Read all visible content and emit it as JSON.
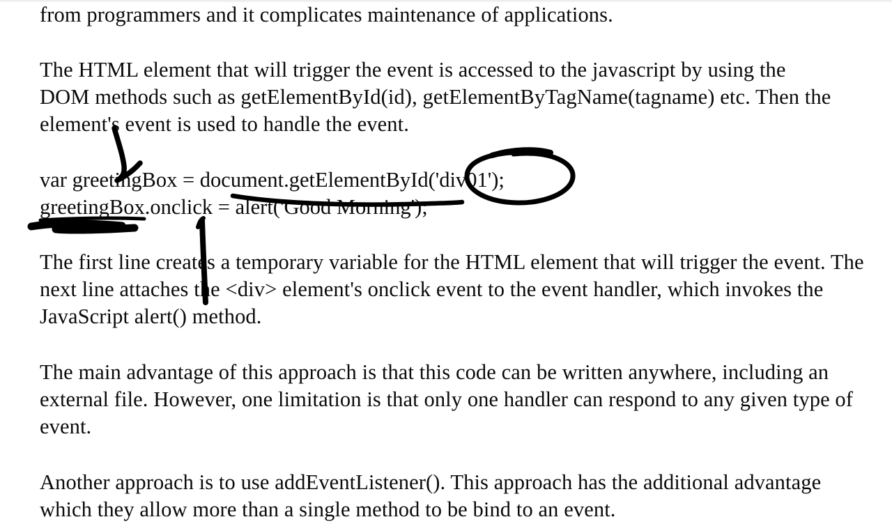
{
  "document": {
    "background_color": "#ffffff",
    "text_color": "#0a0a0a",
    "ink_color": "#000000",
    "paragraphs": {
      "p1_tail": "from programmers and it complicates maintenance of applications.",
      "p2_line1": "The HTML element that will trigger the event is accessed to the javascript by using the",
      "p2_line2": "DOM methods such as getElementById(id), getElementByTagName(tagname) etc. Then the",
      "p2_line3": "element's event is used to handle the event.",
      "p4_line1": "The first line creates a temporary variable for the HTML element that will trigger the event. The",
      "p4_line2": "next line attaches the <div> element's onclick event to the event handler, which invokes the",
      "p4_line3": "JavaScript alert() method.",
      "p5_line1": "The main advantage of this approach is that this code can be written anywhere, including an",
      "p5_line2": "external file. However, one limitation is that only one handler can respond to any given type of",
      "p5_line3": "event.",
      "p6_line1": "Another approach is to use addEventListener(). This approach has the additional advantage",
      "p6_line2_partial": "which they allow more than a single method to be bind to an event."
    },
    "code": {
      "line1": "var greetingBox = document.getElementById('div01');",
      "line2": "greetingBox.onclick = alert('Good Morning');"
    },
    "annotations": [
      {
        "name": "curve-stroke-element-to-greetingbox",
        "type": "freehand-curve",
        "targets": "element's -> greetingBox"
      },
      {
        "name": "ellipse-around-div01",
        "type": "ellipse",
        "targets": "('div01')"
      },
      {
        "name": "strikethrough-alert-good-morning",
        "type": "strikethrough",
        "targets": "alert('Good Morning')"
      },
      {
        "name": "scribble-underline-greetingbox",
        "type": "thick-underline",
        "targets": "greetingBox"
      },
      {
        "name": "vertical-arrow-line",
        "type": "vertical-line-with-arrowhead",
        "targets": "greetingBox.onclick -> paragraph below"
      }
    ]
  }
}
